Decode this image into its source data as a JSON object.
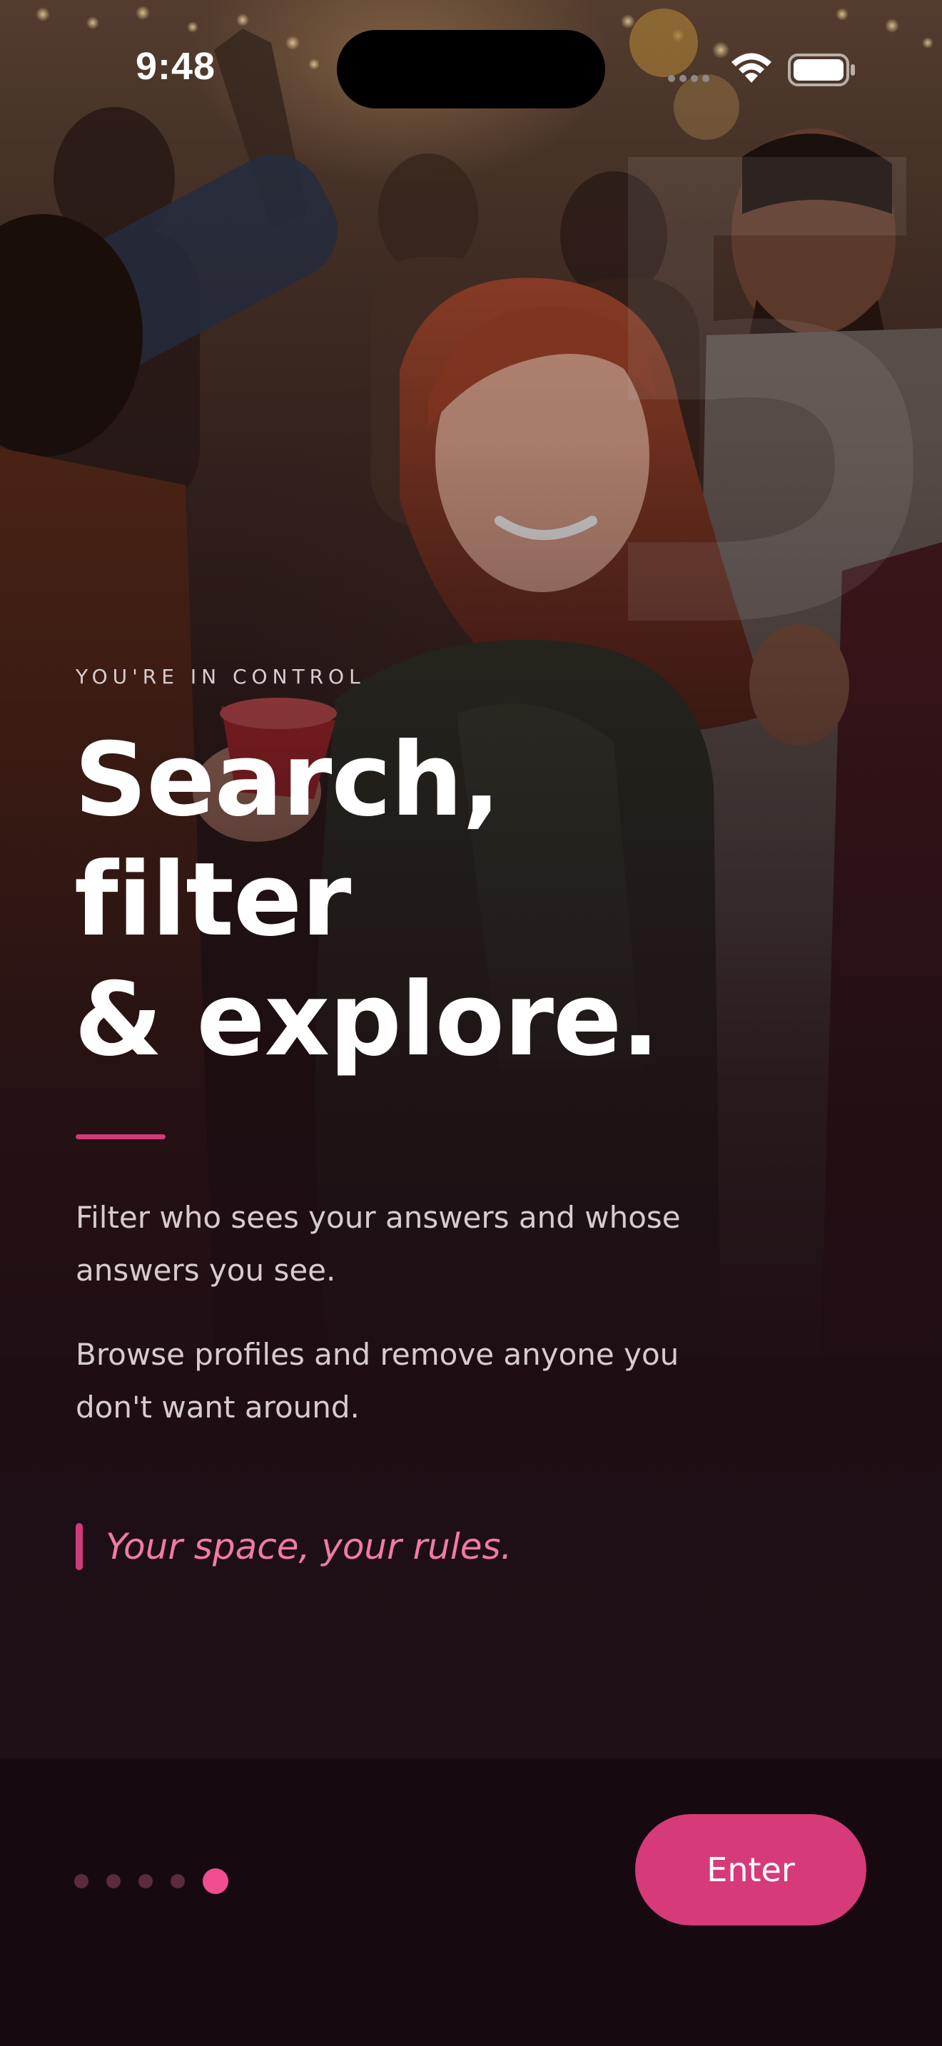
{
  "status_bar": {
    "time": "9:48",
    "signal_icon": "signal-dots-icon",
    "wifi_icon": "wifi-icon",
    "battery_icon": "battery-icon"
  },
  "onboarding": {
    "eyebrow": "YOU'RE IN CONTROL",
    "headline_lines": [
      "Search,",
      "filter",
      "& explore."
    ],
    "body": [
      "Filter who sees your answers and whose answers you see.",
      "Browse profiles and remove anyone you don't want around."
    ],
    "quote": "Your space, your rules."
  },
  "pager": {
    "total_pages": 5,
    "current_page": 5
  },
  "actions": {
    "enter_label": "Enter"
  },
  "colors": {
    "accent": "#d63a78",
    "accent_light": "#f07aa8",
    "background": "#160a10",
    "text_primary": "#ffffff",
    "text_secondary": "#d6cccf"
  }
}
